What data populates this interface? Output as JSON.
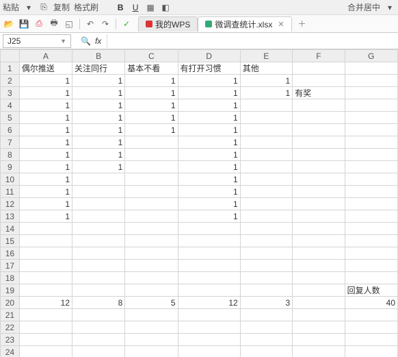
{
  "top": {
    "paste": "粘贴",
    "copy": "复制",
    "brush": "格式刷",
    "merge": "合并居中"
  },
  "tabs": {
    "home": "我的WPS",
    "file": "微调查统计.xlsx"
  },
  "namebox": "J25",
  "cols": [
    "A",
    "B",
    "C",
    "D",
    "E",
    "F",
    "G"
  ],
  "hdr": {
    "a": "偶尔推送",
    "b": "关注同行",
    "c": "基本不看",
    "d": "有打开习惯",
    "e": "其他",
    "f_prize": "有奖",
    "g_count": "回复人数"
  },
  "cells": {
    "r2": {
      "a": "1",
      "b": "1",
      "c": "1",
      "d": "1",
      "e": "1"
    },
    "r3": {
      "a": "1",
      "b": "1",
      "c": "1",
      "d": "1",
      "e": "1"
    },
    "r4": {
      "a": "1",
      "b": "1",
      "c": "1",
      "d": "1"
    },
    "r5": {
      "a": "1",
      "b": "1",
      "c": "1",
      "d": "1"
    },
    "r6": {
      "a": "1",
      "b": "1",
      "c": "1",
      "d": "1"
    },
    "r7": {
      "a": "1",
      "b": "1",
      "d": "1"
    },
    "r8": {
      "a": "1",
      "b": "1",
      "d": "1"
    },
    "r9": {
      "a": "1",
      "b": "1",
      "d": "1"
    },
    "r10": {
      "a": "1",
      "d": "1"
    },
    "r11": {
      "a": "1",
      "d": "1"
    },
    "r12": {
      "a": "1",
      "d": "1"
    },
    "r13": {
      "a": "1",
      "d": "1"
    },
    "r20": {
      "a": "12",
      "b": "8",
      "c": "5",
      "d": "12",
      "e": "3",
      "g": "40"
    }
  },
  "chart_data": {
    "type": "table",
    "title": "微调查统计",
    "columns": [
      "偶尔推送",
      "关注同行",
      "基本不看",
      "有打开习惯",
      "其他"
    ],
    "rows": [
      [
        1,
        1,
        1,
        1,
        1
      ],
      [
        1,
        1,
        1,
        1,
        1
      ],
      [
        1,
        1,
        1,
        1,
        null
      ],
      [
        1,
        1,
        1,
        1,
        null
      ],
      [
        1,
        1,
        1,
        1,
        null
      ],
      [
        1,
        1,
        null,
        1,
        null
      ],
      [
        1,
        1,
        null,
        1,
        null
      ],
      [
        1,
        1,
        null,
        1,
        null
      ],
      [
        1,
        null,
        null,
        1,
        null
      ],
      [
        1,
        null,
        null,
        1,
        null
      ],
      [
        1,
        null,
        null,
        1,
        null
      ],
      [
        1,
        null,
        null,
        1,
        null
      ]
    ],
    "totals": {
      "偶尔推送": 12,
      "关注同行": 8,
      "基本不看": 5,
      "有打开习惯": 12,
      "其他": 3,
      "回复人数": 40
    },
    "note_f3": "有奖"
  }
}
